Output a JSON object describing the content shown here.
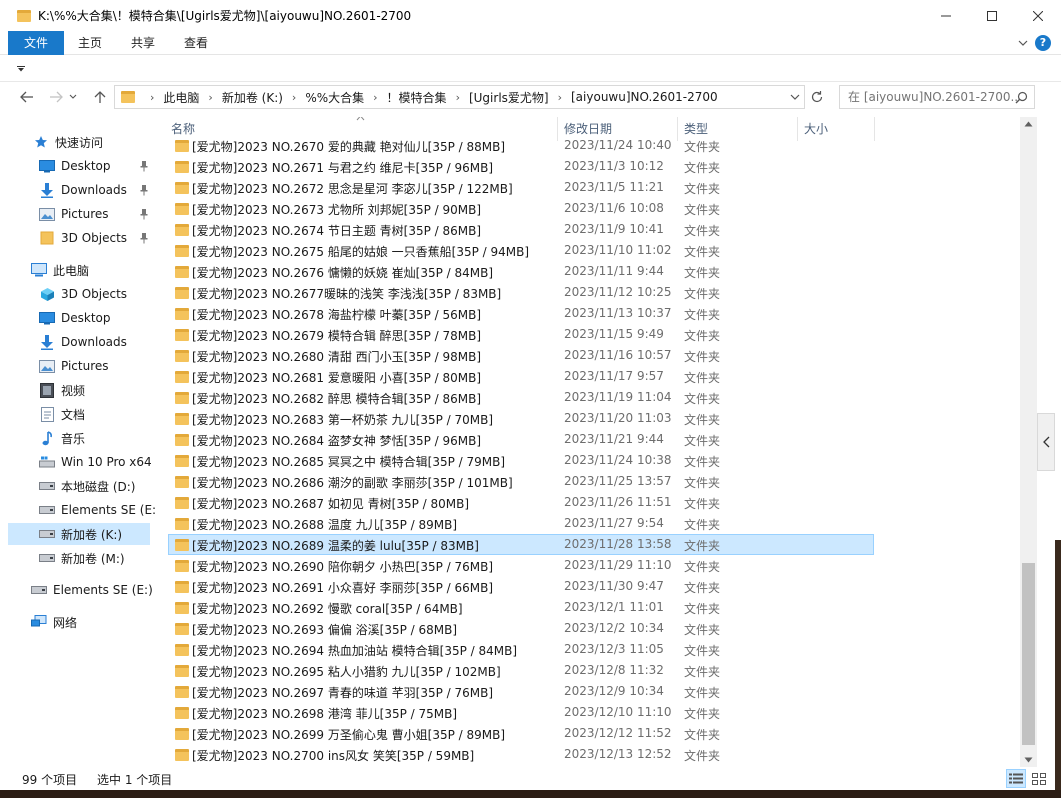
{
  "window": {
    "title": "K:\\%%大合集\\！模特合集\\[Ugirls爱尤物]\\[aiyouwu]NO.2601-2700"
  },
  "ribbon": {
    "tabs": [
      "文件",
      "主页",
      "共享",
      "查看"
    ],
    "help": "?"
  },
  "address": {
    "crumbs": [
      "此电脑",
      "新加卷 (K:)",
      "%%大合集",
      "！模特合集",
      "[Ugirls爱尤物]",
      "[aiyouwu]NO.2601-2700"
    ]
  },
  "search": {
    "placeholder": "在 [aiyouwu]NO.2601-2700..."
  },
  "nav": {
    "quick_access": "快速访问",
    "quick_items": [
      "Desktop",
      "Downloads",
      "Pictures",
      "3D Objects"
    ],
    "this_pc": "此电脑",
    "pc_items": [
      "3D Objects",
      "Desktop",
      "Downloads",
      "Pictures",
      "视频",
      "文档",
      "音乐",
      "Win 10 Pro x64",
      "本地磁盘 (D:)",
      "Elements SE (E:",
      "新加卷 (K:)",
      "新加卷 (M:)"
    ],
    "elements": "Elements SE (E:)",
    "network": "网络"
  },
  "columns": {
    "name": "名称",
    "modified": "修改日期",
    "type": "类型",
    "size": "大小"
  },
  "files": [
    {
      "name": "[爱尤物]2023 NO.2670 爱的典藏 艳对仙儿[35P / 88MB]",
      "date": "2023/11/24 10:40",
      "type": "文件夹"
    },
    {
      "name": "[爱尤物]2023 NO.2671 与君之约 维尼卡[35P / 96MB]",
      "date": "2023/11/3 10:12",
      "type": "文件夹"
    },
    {
      "name": "[爱尤物]2023 NO.2672 思念是星河 李宓儿[35P / 122MB]",
      "date": "2023/11/5 11:21",
      "type": "文件夹"
    },
    {
      "name": "[爱尤物]2023 NO.2673 尤物所 刘邦妮[35P / 90MB]",
      "date": "2023/11/6 10:08",
      "type": "文件夹"
    },
    {
      "name": "[爱尤物]2023 NO.2674 节日主题  青树[35P / 86MB]",
      "date": "2023/11/9 10:41",
      "type": "文件夹"
    },
    {
      "name": "[爱尤物]2023 NO.2675 船尾的姑娘 一只香蕉船[35P / 94MB]",
      "date": "2023/11/10 11:02",
      "type": "文件夹"
    },
    {
      "name": "[爱尤物]2023 NO.2676 慵懒的妖娆 崔灿[35P / 84MB]",
      "date": "2023/11/11 9:44",
      "type": "文件夹"
    },
    {
      "name": "[爱尤物]2023 NO.2677暖昧的浅笑 李浅浅[35P / 83MB]",
      "date": "2023/11/12 10:25",
      "type": "文件夹"
    },
    {
      "name": "[爱尤物]2023 NO.2678 海盐柠檬 叶蓁[35P / 56MB]",
      "date": "2023/11/13 10:37",
      "type": "文件夹"
    },
    {
      "name": "[爱尤物]2023 NO.2679 模特合辑 醉思[35P / 78MB]",
      "date": "2023/11/15 9:49",
      "type": "文件夹"
    },
    {
      "name": "[爱尤物]2023 NO.2680 清甜 西门小玉[35P / 98MB]",
      "date": "2023/11/16 10:57",
      "type": "文件夹"
    },
    {
      "name": "[爱尤物]2023 NO.2681 爱意暖阳 小喜[35P / 80MB]",
      "date": "2023/11/17 9:57",
      "type": "文件夹"
    },
    {
      "name": "[爱尤物]2023 NO.2682 醉思 模特合辑[35P / 86MB]",
      "date": "2023/11/19 11:04",
      "type": "文件夹"
    },
    {
      "name": "[爱尤物]2023 NO.2683 第一杯奶茶 九儿[35P / 70MB]",
      "date": "2023/11/20 11:03",
      "type": "文件夹"
    },
    {
      "name": "[爱尤物]2023 NO.2684 盗梦女神 梦恬[35P / 96MB]",
      "date": "2023/11/21 9:44",
      "type": "文件夹"
    },
    {
      "name": "[爱尤物]2023 NO.2685 冥冥之中 模特合辑[35P / 79MB]",
      "date": "2023/11/24 10:38",
      "type": "文件夹"
    },
    {
      "name": "[爱尤物]2023 NO.2686 潮汐的副歌 李丽莎[35P / 101MB]",
      "date": "2023/11/25 13:57",
      "type": "文件夹"
    },
    {
      "name": "[爱尤物]2023 NO.2687 如初见 青树[35P / 80MB]",
      "date": "2023/11/26 11:51",
      "type": "文件夹"
    },
    {
      "name": "[爱尤物]2023 NO.2688 温度 九儿[35P / 89MB]",
      "date": "2023/11/27 9:54",
      "type": "文件夹"
    },
    {
      "name": "[爱尤物]2023 NO.2689 温柔的姜 lulu[35P / 83MB]",
      "date": "2023/11/28 13:58",
      "type": "文件夹"
    },
    {
      "name": "[爱尤物]2023 NO.2690 陪你朝夕 小热巴[35P / 76MB]",
      "date": "2023/11/29 11:10",
      "type": "文件夹"
    },
    {
      "name": "[爱尤物]2023 NO.2691 小众喜好 李丽莎[35P / 66MB]",
      "date": "2023/11/30 9:47",
      "type": "文件夹"
    },
    {
      "name": "[爱尤物]2023 NO.2692 慢歌 coral[35P / 64MB]",
      "date": "2023/12/1 11:01",
      "type": "文件夹"
    },
    {
      "name": "[爱尤物]2023 NO.2693 偏偏 浴溪[35P / 68MB]",
      "date": "2023/12/2 10:34",
      "type": "文件夹"
    },
    {
      "name": "[爱尤物]2023 NO.2694 热血加油站 模特合辑[35P / 84MB]",
      "date": "2023/12/3 11:05",
      "type": "文件夹"
    },
    {
      "name": "[爱尤物]2023 NO.2695 粘人小猎豹 九儿[35P / 102MB]",
      "date": "2023/12/8 11:32",
      "type": "文件夹"
    },
    {
      "name": "[爱尤物]2023 NO.2697 青春的味道 芊羽[35P / 76MB]",
      "date": "2023/12/9 10:34",
      "type": "文件夹"
    },
    {
      "name": "[爱尤物]2023 NO.2698 港湾 菲儿[35P / 75MB]",
      "date": "2023/12/10 11:10",
      "type": "文件夹"
    },
    {
      "name": "[爱尤物]2023 NO.2699 万圣偷心鬼 曹小姐[35P / 89MB]",
      "date": "2023/12/12 11:52",
      "type": "文件夹"
    },
    {
      "name": "[爱尤物]2023 NO.2700 ins风女 笑笑[35P / 59MB]",
      "date": "2023/12/13 12:52",
      "type": "文件夹"
    }
  ],
  "selected_index": 19,
  "status": {
    "count": "99 个项目",
    "selected": "选中 1 个项目"
  },
  "colors": {
    "accent": "#1979ca",
    "selection": "#cce8ff",
    "folder": "#f4c35c"
  }
}
